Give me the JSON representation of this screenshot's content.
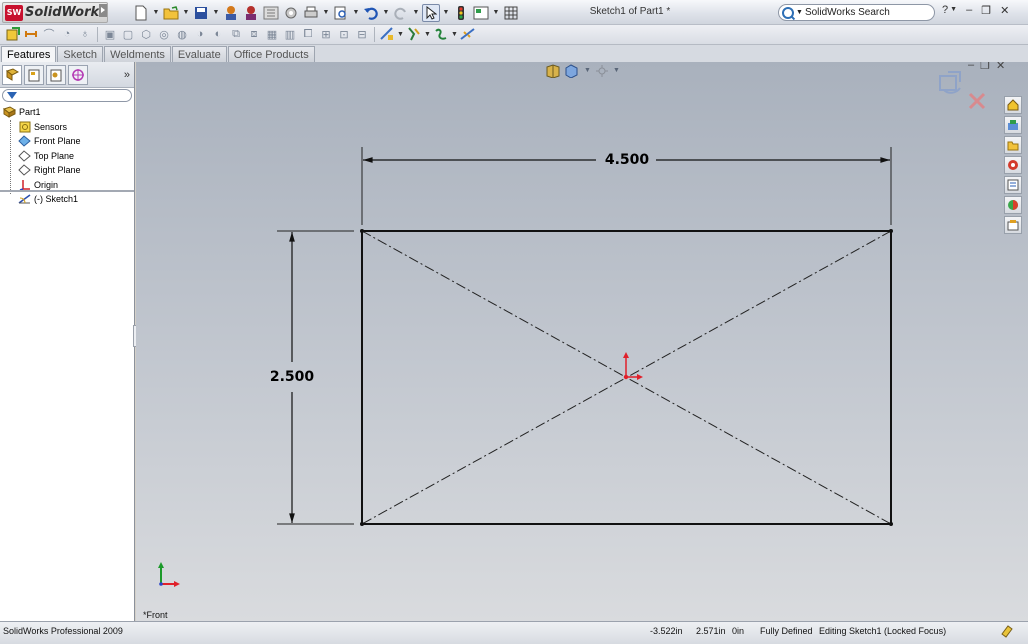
{
  "app": {
    "title": "SolidWorks",
    "badge": "SW"
  },
  "window": {
    "document_title": "Sketch1 of Part1 *"
  },
  "search": {
    "label": "SolidWorks Search"
  },
  "tabs": [
    {
      "label": "Features",
      "active": true
    },
    {
      "label": "Sketch",
      "active": false
    },
    {
      "label": "Weldments",
      "active": false
    },
    {
      "label": "Evaluate",
      "active": false
    },
    {
      "label": "Office Products",
      "active": false
    }
  ],
  "feature_tree": {
    "root": "Part1",
    "items": [
      {
        "label": "Sensors",
        "icon": "sensors-icon"
      },
      {
        "label": "Front Plane",
        "icon": "plane-icon"
      },
      {
        "label": "Top Plane",
        "icon": "plane-icon"
      },
      {
        "label": "Right Plane",
        "icon": "plane-icon"
      },
      {
        "label": "Origin",
        "icon": "origin-icon"
      },
      {
        "label": "(-) Sketch1",
        "icon": "sketch-icon"
      }
    ],
    "more_label": "»"
  },
  "sketch": {
    "dimensions": {
      "width": "4.500",
      "height": "2.500"
    }
  },
  "view": {
    "name": "*Front"
  },
  "status": {
    "product": "SolidWorks Professional 2009",
    "x": "-3.522in",
    "y": "2.571in",
    "z": "0in",
    "state": "Fully Defined",
    "editing": "Editing Sketch1 (Locked Focus)"
  },
  "colors": {
    "origin_red": "#e0202a",
    "axis_green": "#1c9a2a",
    "axis_blue": "#2a45c8",
    "sketch_line": "#111111"
  }
}
